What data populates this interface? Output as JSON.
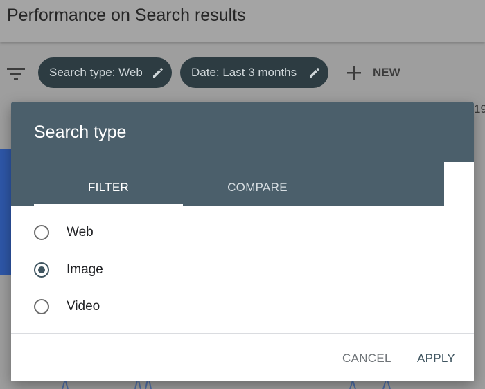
{
  "page": {
    "title": "Performance on Search results",
    "filters": [
      {
        "label": "Search type: Web"
      },
      {
        "label": "Date: Last 3 months"
      }
    ],
    "new_label": "NEW",
    "side_fragment": "19"
  },
  "dialog": {
    "title": "Search type",
    "tabs": [
      {
        "label": "FILTER",
        "active": true
      },
      {
        "label": "COMPARE",
        "active": false
      }
    ],
    "options": [
      {
        "label": "Web",
        "selected": false
      },
      {
        "label": "Image",
        "selected": true
      },
      {
        "label": "Video",
        "selected": false
      }
    ],
    "cancel_label": "CANCEL",
    "apply_label": "APPLY"
  },
  "colors": {
    "dialog_header": "#4b5f6b",
    "chip_bg": "#2d3c42",
    "accent": "#3f5560"
  },
  "icons": {
    "filter": "filter-icon",
    "edit": "pencil-icon",
    "add": "plus-icon"
  }
}
